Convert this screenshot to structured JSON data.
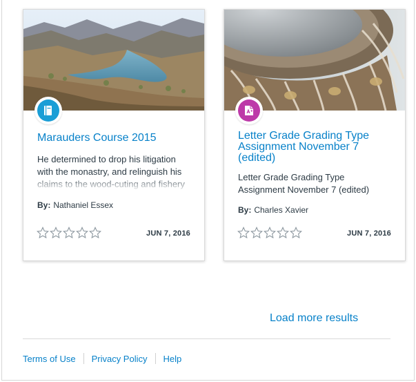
{
  "cards": [
    {
      "title": "Marauders Course 2015",
      "type_icon": "course-book-icon",
      "badge_color": "#1a9ed6",
      "description": "He determined to drop his litigation with the monastry, and relinguish his claims to the wood-cuting and fishery",
      "author_label": "By:",
      "author": "Nathaniel Essex",
      "rating": 0,
      "date": "JUN 7, 2016"
    },
    {
      "title": "Letter Grade Grading Type Assignment November 7 (edited)",
      "type_icon": "assignment-icon",
      "badge_color": "#bd39a8",
      "description": "Letter Grade Grading Type Assignment November 7 (edited)",
      "author_label": "By:",
      "author": "Charles Xavier",
      "rating": 0,
      "date": "JUN 7, 2016"
    }
  ],
  "load_more": "Load more results",
  "footer": {
    "links": [
      "Terms of Use",
      "Privacy Policy",
      "Help"
    ]
  },
  "colors": {
    "link": "#0781c9",
    "text": "#2d3b45"
  }
}
